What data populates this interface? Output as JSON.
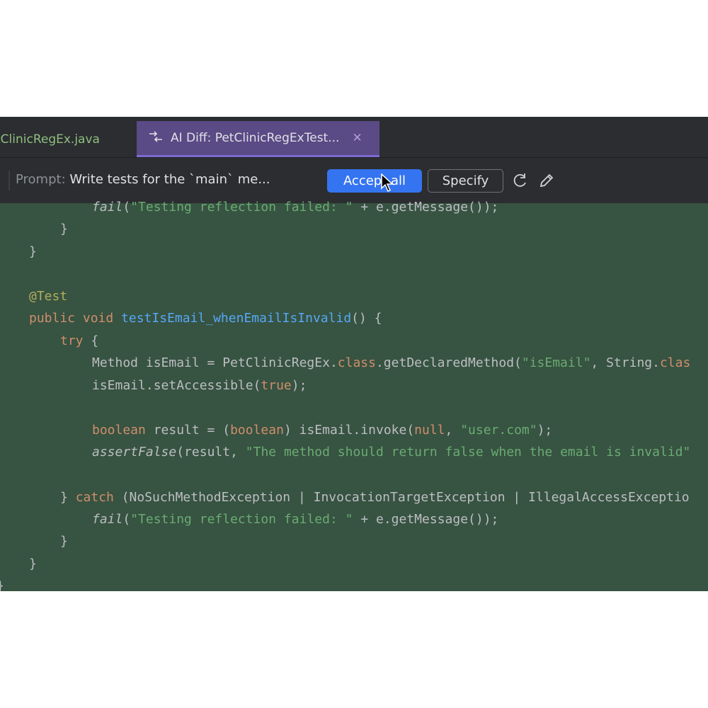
{
  "tabs": [
    {
      "label": "tClinicRegEx.java",
      "active": false
    },
    {
      "label": "AI Diff: PetClinicRegExTest...",
      "active": true
    }
  ],
  "prompt": {
    "label": "Prompt:",
    "text": "Write tests for the `main` me..."
  },
  "actions": {
    "accept_all": "Accept all",
    "specify": "Specify"
  },
  "icons": [
    "diff-arrows-icon",
    "close-icon",
    "refresh-icon",
    "pencil-icon",
    "mouse-cursor"
  ],
  "colors": {
    "editor_bg": "#375341",
    "chrome_bg": "#2b2d30",
    "active_tab": "#5a4a85",
    "primary_button": "#3574f0"
  },
  "code": {
    "l1a": "fail",
    "l1b": "(",
    "l1c": "\"Testing reflection failed: \"",
    "l1d": " + e.getMessage());",
    "l2": "}",
    "l3": "}",
    "l4": "@Test",
    "l5a": "public void ",
    "l5b": "testIsEmail_whenEmailIsInvalid",
    "l5c": "() {",
    "l6a": "try",
    "l6b": " {",
    "l7a": "Method isEmail = PetClinicRegEx.",
    "l7b": "class",
    "l7c": ".getDeclaredMethod(",
    "l7d": "\"isEmail\"",
    "l7e": ", String.",
    "l7f": "clas",
    "l8a": "isEmail.setAccessible(",
    "l8b": "true",
    "l8c": ");",
    "l9a": "boolean",
    "l9b": " result = (",
    "l9c": "boolean",
    "l9d": ") isEmail.invoke(",
    "l9e": "null",
    "l9f": ", ",
    "l9g": "\"user.com\"",
    "l9h": ");",
    "l10a": "assertFalse",
    "l10b": "(result, ",
    "l10c": "\"The method should return false when the email is invalid\"",
    "l11a": "} ",
    "l11b": "catch",
    "l11c": " (NoSuchMethodException | InvocationTargetException | IllegalAccessExceptio",
    "l12a": "fail",
    "l12b": "(",
    "l12c": "\"Testing reflection failed: \"",
    "l12d": " + e.getMessage());",
    "l13": "}",
    "l14": "}",
    "l15": "}"
  }
}
